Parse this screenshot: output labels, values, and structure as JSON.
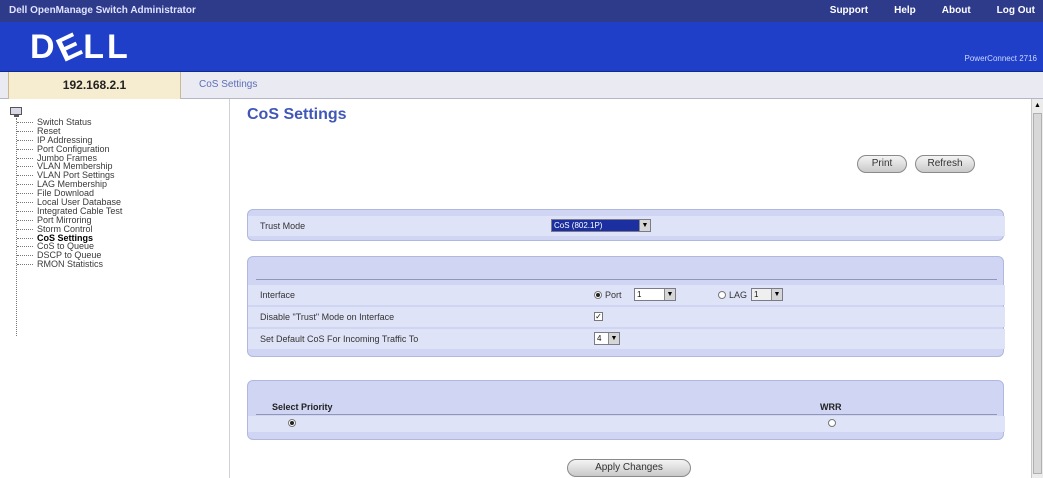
{
  "topbar": {
    "title": "Dell OpenManage Switch Administrator",
    "links": [
      "Support",
      "Help",
      "About",
      "Log Out"
    ]
  },
  "banner": {
    "logo": "DELL",
    "product": "PowerConnect 2716"
  },
  "address": {
    "ip": "192.168.2.1",
    "breadcrumb": "CoS Settings"
  },
  "sidebar": {
    "items": [
      "Switch Status",
      "Reset",
      "IP Addressing",
      "Port Configuration",
      "Jumbo Frames",
      "VLAN Membership",
      "VLAN Port Settings",
      "LAG Membership",
      "File Download",
      "Local User Database",
      "Integrated Cable Test",
      "Port Mirroring",
      "Storm Control",
      "CoS Settings",
      "CoS to Queue",
      "DSCP to Queue",
      "RMON Statistics"
    ],
    "active_index": 13
  },
  "main": {
    "title": "CoS Settings",
    "print_label": "Print",
    "refresh_label": "Refresh",
    "apply_label": "Apply Changes",
    "trust_mode_label": "Trust Mode",
    "trust_mode_value": "CoS (802.1P)",
    "interface_label": "Interface",
    "port_label": "Port",
    "port_value": "1",
    "lag_label": "LAG",
    "lag_value": "1",
    "disable_trust_label": "Disable \"Trust\" Mode on Interface",
    "disable_trust_checked": true,
    "default_cos_label": "Set Default CoS For Incoming Traffic To",
    "default_cos_value": "4",
    "select_priority_label": "Select Priority",
    "wrr_label": "WRR",
    "strict_selected": true,
    "wrr_selected": false
  },
  "colors": {
    "topbar": "#2e3a8a",
    "banner": "#1f3fc9",
    "panel": "#cfd5f3",
    "title": "#4057b8"
  }
}
